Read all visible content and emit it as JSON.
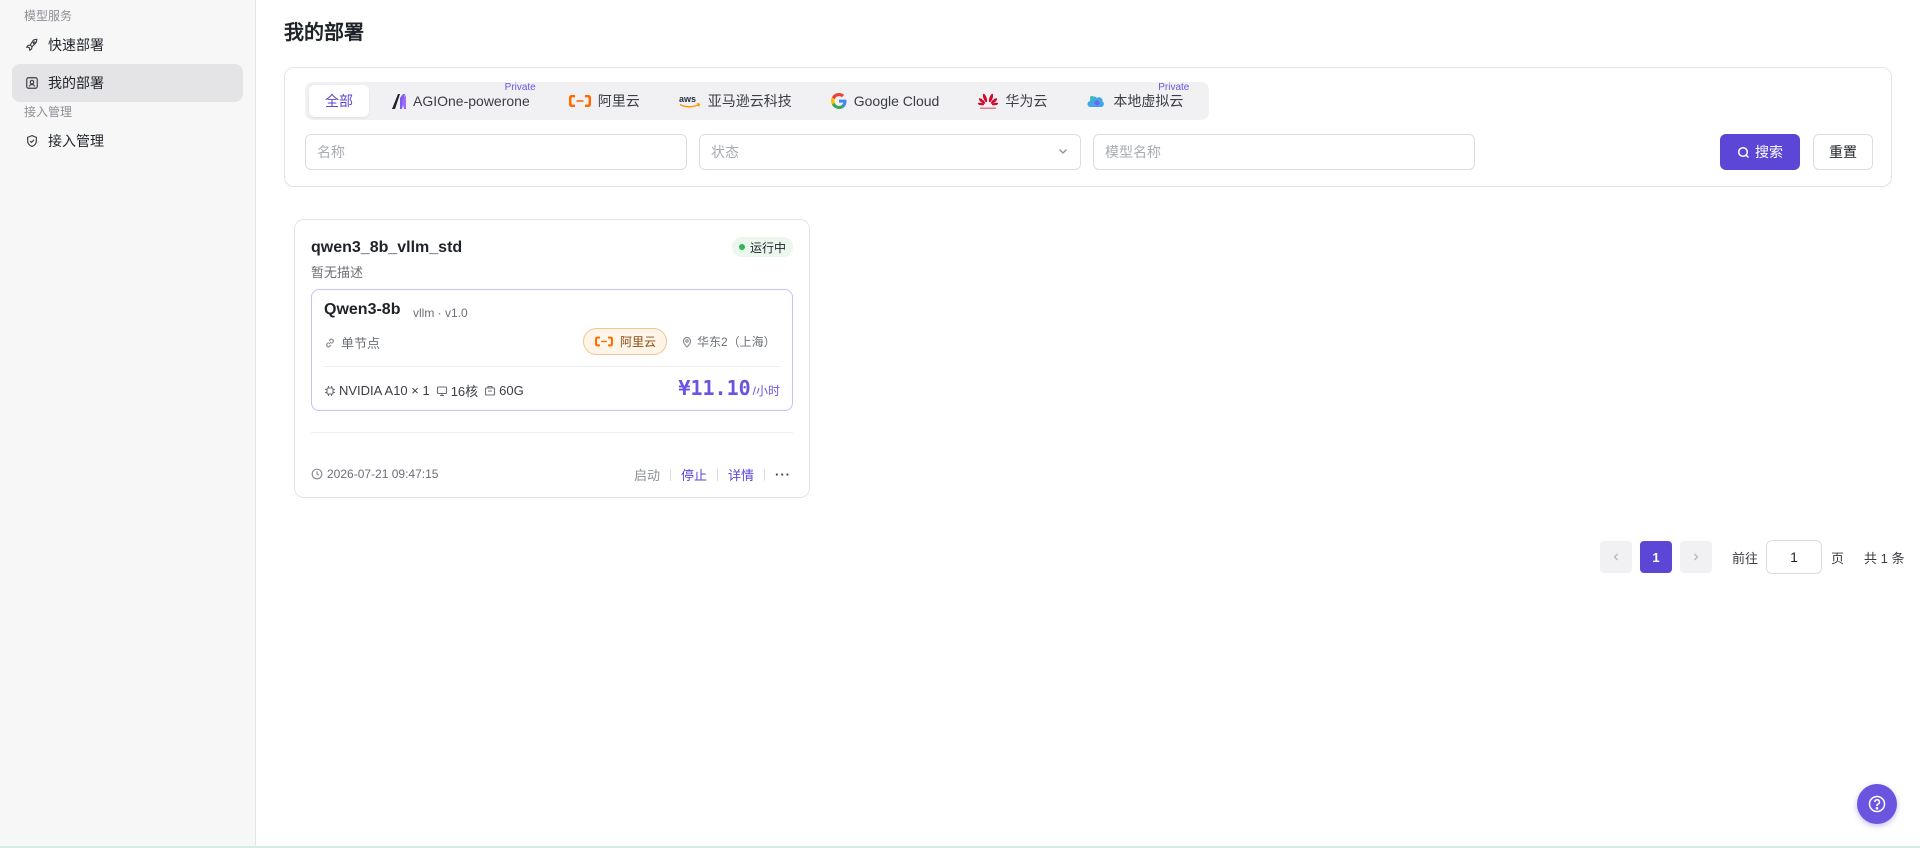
{
  "sidebar": {
    "groups": [
      {
        "title": "模型服务",
        "items": [
          {
            "label": "快速部署",
            "icon": "rocket-icon"
          },
          {
            "label": "我的部署",
            "icon": "deploy-icon",
            "active": true
          }
        ]
      },
      {
        "title": "接入管理",
        "items": [
          {
            "label": "接入管理",
            "icon": "shield-icon"
          }
        ]
      }
    ]
  },
  "page": {
    "title": "我的部署"
  },
  "filters": {
    "tabs": [
      {
        "label": "全部",
        "active": true
      },
      {
        "label": "AGIOne-powerone",
        "badge": "Private",
        "icon": "agione-logo"
      },
      {
        "label": "阿里云",
        "icon": "aliyun-logo"
      },
      {
        "label": "亚马逊云科技",
        "icon": "aws-logo"
      },
      {
        "label": "Google Cloud",
        "icon": "google-logo"
      },
      {
        "label": "华为云",
        "icon": "huawei-logo"
      },
      {
        "label": "本地虚拟云",
        "badge": "Private",
        "icon": "local-cloud-logo"
      }
    ],
    "name_placeholder": "名称",
    "status_placeholder": "状态",
    "model_placeholder": "模型名称",
    "search_label": "搜索",
    "reset_label": "重置"
  },
  "card": {
    "name": "qwen3_8b_vllm_std",
    "description": "暂无描述",
    "status": "运行中",
    "model_name": "Qwen3-8b",
    "model_meta": "vllm · v1.0",
    "deploy_type": "单节点",
    "provider": "阿里云",
    "region": "华东2（上海）",
    "gpu": "NVIDIA A10 × 1",
    "cpu": "16核",
    "memory": "60G",
    "price": "¥11.10",
    "price_unit": "/小时",
    "created_at": "2026-07-21 09:47:15",
    "actions": {
      "start": "启动",
      "stop": "停止",
      "detail": "详情",
      "more": "···"
    }
  },
  "pagination": {
    "current_page": "1",
    "goto_label": "前往",
    "goto_value": "1",
    "page_suffix": "页",
    "total": "共 1 条"
  },
  "colors": {
    "accent": "#5b46d6",
    "running": "#34b35a",
    "aliyun": "#ff6a00"
  }
}
